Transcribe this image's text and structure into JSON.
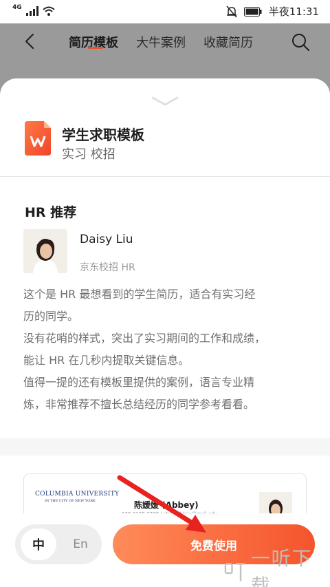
{
  "status_bar": {
    "network": "4G",
    "time": "半夜11:31"
  },
  "nav": {
    "tabs": [
      {
        "label": "简历模板",
        "active": true
      },
      {
        "label": "大牛案例",
        "active": false
      },
      {
        "label": "收藏简历",
        "active": false
      }
    ]
  },
  "template": {
    "title": "学生求职模板",
    "tags": "实习 校招",
    "icon_letter": "W"
  },
  "hr_recommend": {
    "heading": "HR 推荐",
    "name": "Daisy  Liu",
    "role": "京东校招  HR",
    "description_lines": [
      "这个是 HR 最想看到的学生简历，适合有实习经",
      "历的同学。",
      "没有花哨的样式，突出了实习期间的工作和成绩，",
      "能让 HR 在几秒内提取关键信息。",
      "值得一提的还有模板里提供的案例，语言专业精",
      "炼，非常推荐不擅长总结经历的同学参考看看。"
    ]
  },
  "preview": {
    "university": "COLUMBIA UNIVERSITY",
    "university_sub": "IN THE CITY OF NEW YORK",
    "cv_name": "陈媛媛 (Abbey)",
    "cv_contact": "138-0138-2300 | chen.abbey@mail.edu"
  },
  "bottom": {
    "lang_zh": "中",
    "lang_en": "En",
    "use_button": "免费使用"
  },
  "watermark": {
    "text": "一听下载"
  },
  "colors": {
    "accent": "#e8552d",
    "button_start": "#ff8b5a",
    "button_end": "#f5542c",
    "dim_overlay": "#9a9a9a"
  }
}
